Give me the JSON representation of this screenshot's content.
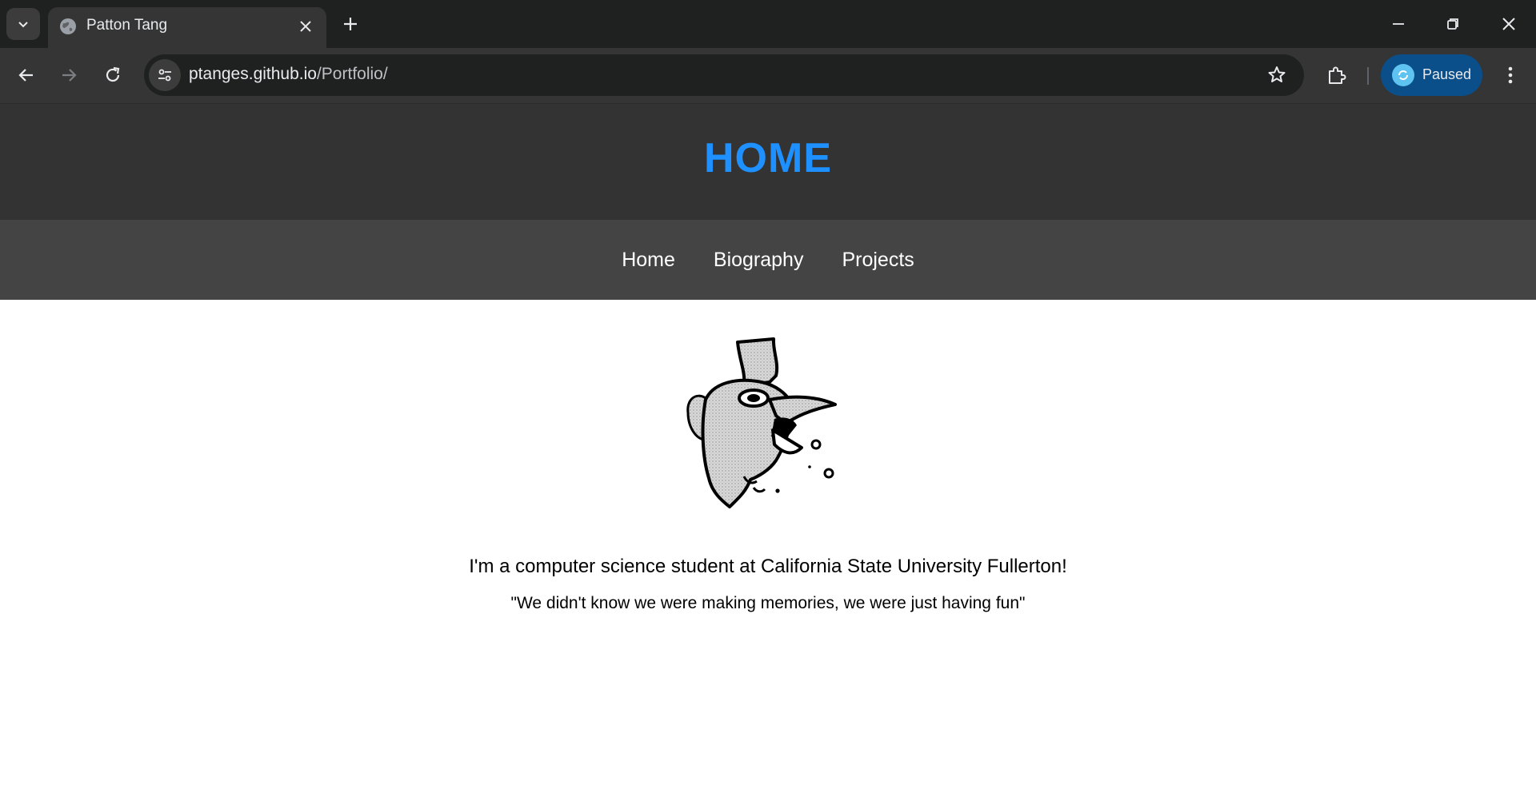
{
  "browser": {
    "tab": {
      "title": "Patton Tang",
      "favicon": "globe-icon"
    },
    "url": {
      "host": "ptanges.github.io",
      "path": "/Portfolio/"
    },
    "profile": {
      "label": "Paused"
    },
    "colors": {
      "tabstrip": "#1f2020",
      "toolbar": "#353535",
      "profile_bg": "#0b4f8a"
    }
  },
  "site": {
    "header": {
      "title": "HOME",
      "color": "#1e90ff"
    },
    "nav": [
      {
        "label": "Home"
      },
      {
        "label": "Biography"
      },
      {
        "label": "Projects"
      }
    ],
    "image": {
      "icon": "bird-illustration"
    },
    "intro": "I'm a computer science student at California State University Fullerton!",
    "quote": "\"We didn't know we were making memories, we were just having fun\""
  }
}
